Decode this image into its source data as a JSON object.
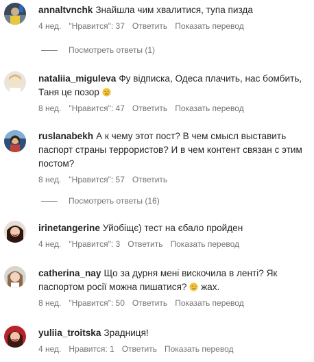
{
  "comments": [
    {
      "username": "annaltvnchk",
      "text": "Знайшла чим хвалитися, тупа пизда",
      "time": "4 нед.",
      "likes": "\"Нравится\": 37",
      "reply": "Ответить",
      "translate": "Показать перевод",
      "replies": "Посмотреть ответы (1)"
    },
    {
      "username": "nataliia_miguleva",
      "text": "Фу відписка, Одеса плачить, нас бомбить, Таня це позор",
      "emoji": "crying-face",
      "time": "8 нед.",
      "likes": "\"Нравится\": 47",
      "reply": "Ответить",
      "translate": "Показать перевод"
    },
    {
      "username": "ruslanabekh",
      "text": "А к чему этот пост? В чем смысл выставить паспорт страны террористов? И в чем контент связан с этим постом?",
      "time": "8 нед.",
      "likes": "\"Нравится\": 57",
      "reply": "Ответить",
      "replies": "Посмотреть ответы (16)"
    },
    {
      "username": "irinetangerine",
      "text": "Уйобіщє) тест на єбало пройден",
      "time": "4 нед.",
      "likes": "\"Нравится\": 3",
      "reply": "Ответить",
      "translate": "Показать перевод"
    },
    {
      "username": "catherina_nay",
      "text": "Що за дурня мені вискочила в ленті? Як паспортом росії можна пишатися?",
      "emoji": "crying-face",
      "text_after": "жах.",
      "time": "8 нед.",
      "likes": "\"Нравится\": 50",
      "reply": "Ответить",
      "translate": "Показать перевод"
    },
    {
      "username": "yuliia_troitska",
      "text": "Зрадниця!",
      "time": "4 нед.",
      "likes": "Нравится: 1",
      "reply": "Ответить",
      "translate": "Показать перевод"
    }
  ]
}
